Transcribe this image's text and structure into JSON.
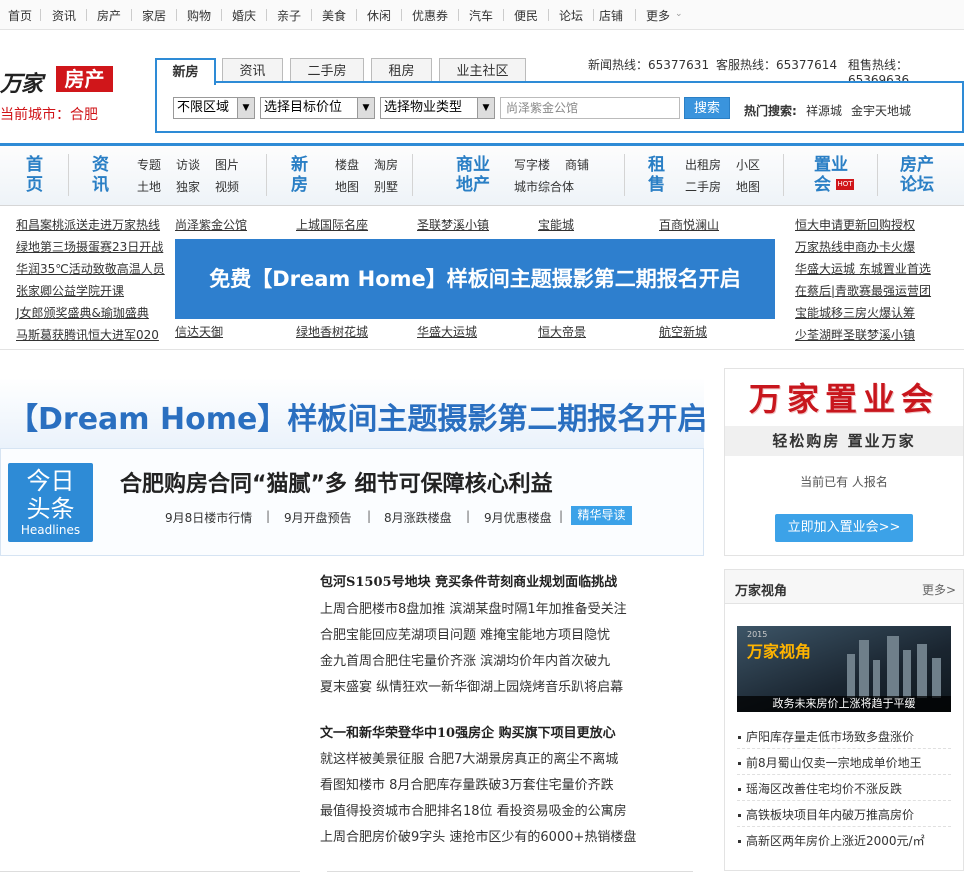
{
  "topnav": [
    "首页",
    "资讯",
    "房产",
    "家居",
    "购物",
    "婚庆",
    "亲子",
    "美食",
    "休闲",
    "优惠券",
    "汽车",
    "便民",
    "论坛",
    "店铺",
    "更多"
  ],
  "logo": {
    "brand": "万家",
    "channel": "房产"
  },
  "city": "当前城市：合肥",
  "search_tabs": [
    "新房",
    "资讯",
    "二手房",
    "租房",
    "业主社区"
  ],
  "hotlines": [
    "新闻热线：65377631",
    "客服热线：65377614",
    "租售热线：65369636"
  ],
  "selects": [
    "不限区域",
    "选择目标价位",
    "选择物业类型"
  ],
  "search": {
    "value": "尚泽紫金公馆",
    "button": "搜索",
    "hot_label": "热门搜索:",
    "hot": [
      "祥源城",
      "金宇天地城"
    ]
  },
  "channels": {
    "shouye": [
      "首",
      "页"
    ],
    "zixun": [
      "资",
      "讯"
    ],
    "zixun_links": [
      "专题",
      "访谈",
      "图片",
      "土地",
      "独家",
      "视频"
    ],
    "xinfang": [
      "新",
      "房"
    ],
    "xinfang_links": [
      "楼盘",
      "淘房",
      "地图",
      "别墅"
    ],
    "shangye": [
      "商业",
      "地产"
    ],
    "shangye_links": [
      "写字楼",
      "商铺",
      "城市综合体"
    ],
    "zushou": [
      "租",
      "售"
    ],
    "zushou_links": [
      "出租房",
      "小区",
      "二手房",
      "地图"
    ],
    "zhiye": [
      "置业",
      "会"
    ],
    "hot": "HOT",
    "luntan": [
      "房产",
      "论坛"
    ]
  },
  "links_left": [
    "和昌案桃派送走进万家热线",
    "绿地第三场摄蛋赛23日开战",
    "华润35℃活动致敬高温人员",
    "张家卿公益学院开课",
    "J女郎颁奖盛典&瑜珈盛典",
    "马斯葛获腾讯恒大进军020"
  ],
  "links_top": [
    "尚泽紫金公馆",
    "上城国际名座",
    "圣联梦溪小镇",
    "宝能城",
    "百商悦澜山"
  ],
  "links_bottom": [
    "信达天御",
    "绿地香树花城",
    "华盛大运城",
    "恒大帝景",
    "航空新城"
  ],
  "links_right": [
    "恒大申请更新回购授权",
    "万家热线申商办卡火爆",
    "华盛大运城 东城置业首选",
    "在蔡后|青歌赛最强运营团",
    "宝能城移三房火爆认筹",
    "少荃湖畔圣联梦溪小镇"
  ],
  "banner": "免费【Dream Home】样板间主题摄影第二期报名开启",
  "dream_title": "【Dream Home】样板间主题摄影第二期报名开启",
  "toutiao": {
    "a": "今日",
    "b": "头条",
    "c": "Headlines"
  },
  "headline": "合肥购房合同“猫腻”多 细节可保障核心利益",
  "sub_links": [
    "9月8日楼市行情",
    "9月开盘预告",
    "8月涨跌楼盘",
    "9月优惠楼盘"
  ],
  "sep": "|",
  "jinghua": "精华导读",
  "news1": {
    "head": "包河S1505号地块 竞买条件苛刻商业规划面临挑战",
    "items": [
      "上周合肥楼市8盘加推 滨湖某盘时隔1年加推备受关注",
      "合肥宝能回应芜湖项目问题 难掩宝能地方项目隐忧",
      "金九首周合肥住宅量价齐涨 滨湖均价年内首次破九",
      "夏末盛宴 纵情狂欢一新华御湖上园烧烤音乐趴将启幕"
    ]
  },
  "news2": {
    "head": "文一和新华荣登华中10强房企 购买旗下项目更放心",
    "items": [
      "就这样被美景征服 合肥7大湖景房真正的离尘不离城",
      "看图知楼市 8月合肥库存量跌破3万套住宅量价齐跌",
      "最值得投资城市合肥排名18位 看投资易吸金的公寓房",
      "上周合肥房价破9字头 速抢市区少有的6000+热销楼盘"
    ]
  },
  "zhiyehui": {
    "title": "万家置业会",
    "sub": "轻松购房 置业万家",
    "txt": "当前已有 人报名",
    "btn": "立即加入置业会>>"
  },
  "wjsj": {
    "title": "万家视角",
    "more": "更多>",
    "img_year": "2015",
    "img_brand": "万家视角",
    "img_caption": "政务未来房价上涨将趋于平缓",
    "items": [
      "庐阳库存量走低市场致多盘涨价",
      "前8月蜀山仅卖一宗地成单价地王",
      "瑶海区改善住宅均价不涨反跌",
      "高铁板块项目年内破万推高房价",
      "高新区两年房价上涨近2000元/㎡"
    ]
  }
}
